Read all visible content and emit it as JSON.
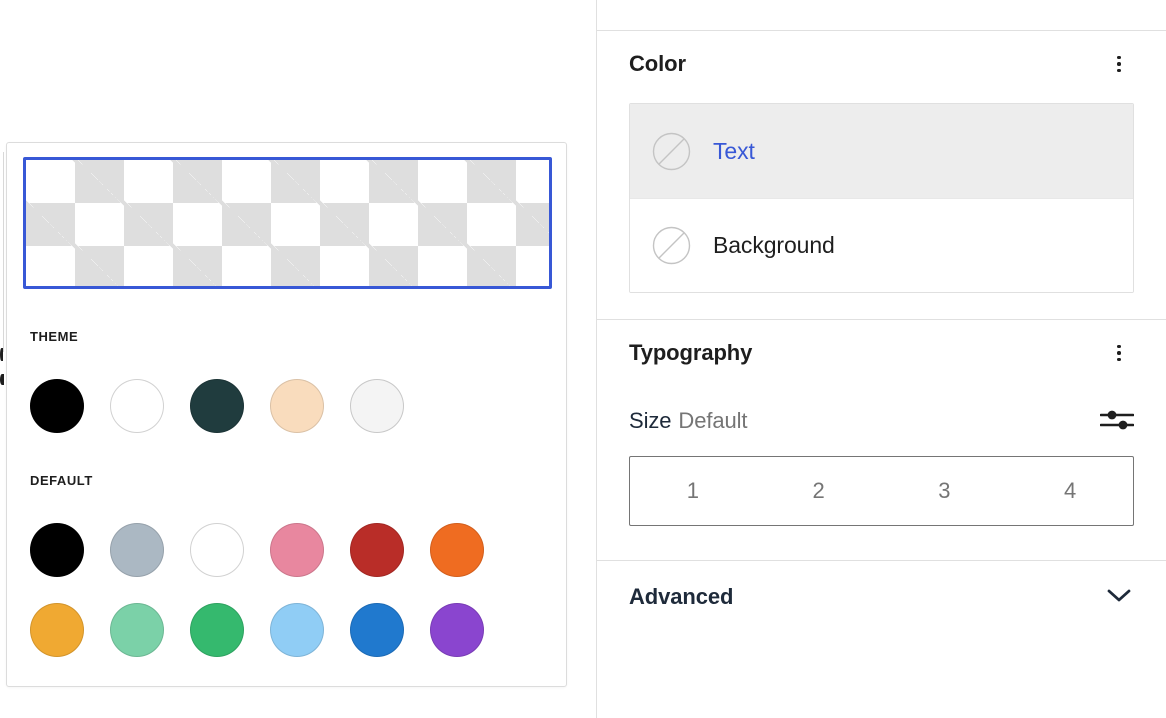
{
  "picker": {
    "preview": {
      "name": "transparent-preview",
      "state": "transparent-checkerboard",
      "selected_border_color": "#3858d6"
    },
    "groups": [
      {
        "label": "THEME",
        "swatches": [
          {
            "name": "Black",
            "hex": "#000000"
          },
          {
            "name": "White",
            "hex": "#ffffff"
          },
          {
            "name": "Dark teal",
            "hex": "#203c3e"
          },
          {
            "name": "Peach",
            "hex": "#f9dcbd"
          },
          {
            "name": "Off white",
            "hex": "#f4f4f4"
          }
        ]
      },
      {
        "label": "DEFAULT",
        "swatches": [
          {
            "name": "Black",
            "hex": "#000000"
          },
          {
            "name": "Cyan bluish gray",
            "hex": "#abb8c3"
          },
          {
            "name": "White",
            "hex": "#ffffff"
          },
          {
            "name": "Pale pink",
            "hex": "#e8879f"
          },
          {
            "name": "Vivid red",
            "hex": "#b92d28"
          },
          {
            "name": "Luminous vivid orange",
            "hex": "#ef6c21"
          },
          {
            "name": "Luminous vivid amber",
            "hex": "#f0a932"
          },
          {
            "name": "Light green cyan",
            "hex": "#7bd1a8"
          },
          {
            "name": "Vivid green cyan",
            "hex": "#35b96e"
          },
          {
            "name": "Pale cyan blue",
            "hex": "#90cdf5"
          },
          {
            "name": "Vivid cyan blue",
            "hex": "#2079ce"
          },
          {
            "name": "Vivid purple",
            "hex": "#8a45cf"
          }
        ]
      }
    ]
  },
  "sidebar": {
    "color_panel": {
      "title": "Color",
      "menu_icon": "kebab-menu-icon",
      "rows": [
        {
          "label": "Text",
          "icon": "no-color-icon",
          "selected": true
        },
        {
          "label": "Background",
          "icon": "no-color-icon",
          "selected": false
        }
      ]
    },
    "typography_panel": {
      "title": "Typography",
      "menu_icon": "kebab-menu-icon",
      "size_label": "Size",
      "size_value": "Default",
      "settings_icon": "sliders-icon",
      "size_options": [
        "1",
        "2",
        "3",
        "4"
      ]
    },
    "advanced_panel": {
      "title": "Advanced",
      "chevron_icon": "chevron-down-icon"
    }
  },
  "colors": {
    "accent_blue": "#3858d6",
    "selected_row_bg": "#ededed",
    "border": "#e0e0e0",
    "muted_text": "#757575"
  }
}
